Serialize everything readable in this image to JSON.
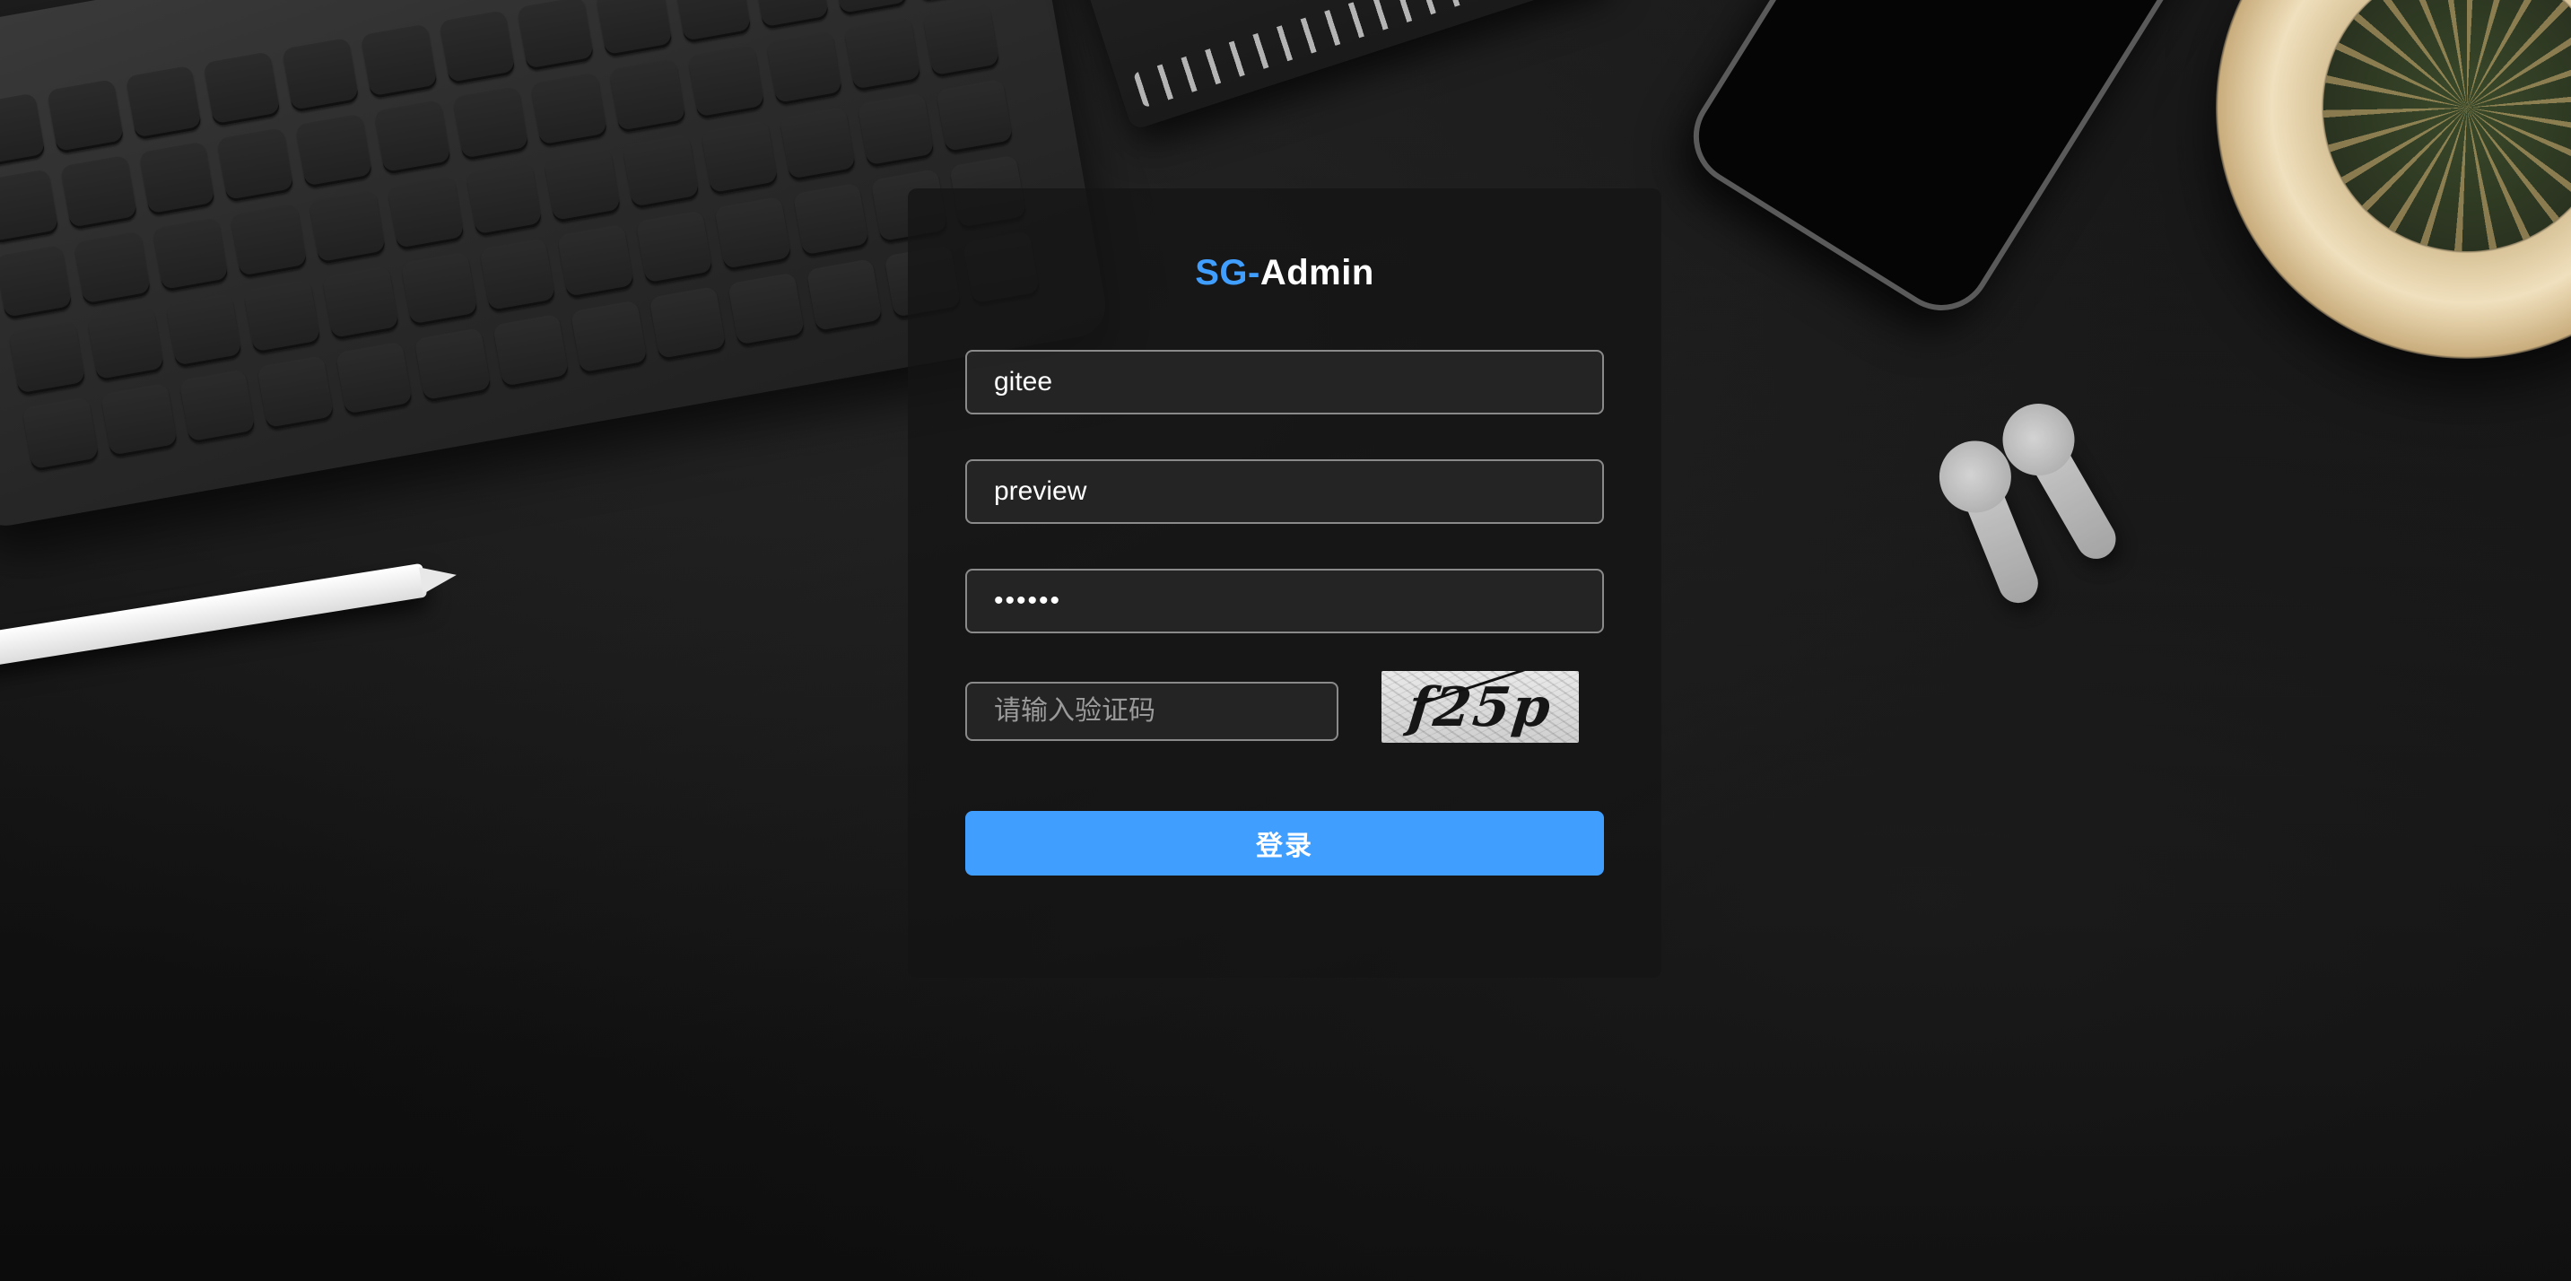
{
  "brand": {
    "prefix": "SG-",
    "name": "Admin",
    "accent_color": "#409eff"
  },
  "form": {
    "username_value": "gitee",
    "account_value": "preview",
    "password_value": "••••••",
    "captcha_placeholder": "请输入验证码",
    "captcha_image_text": "f25p",
    "login_label": "登录"
  },
  "icons": {
    "captcha": "captcha-image"
  }
}
